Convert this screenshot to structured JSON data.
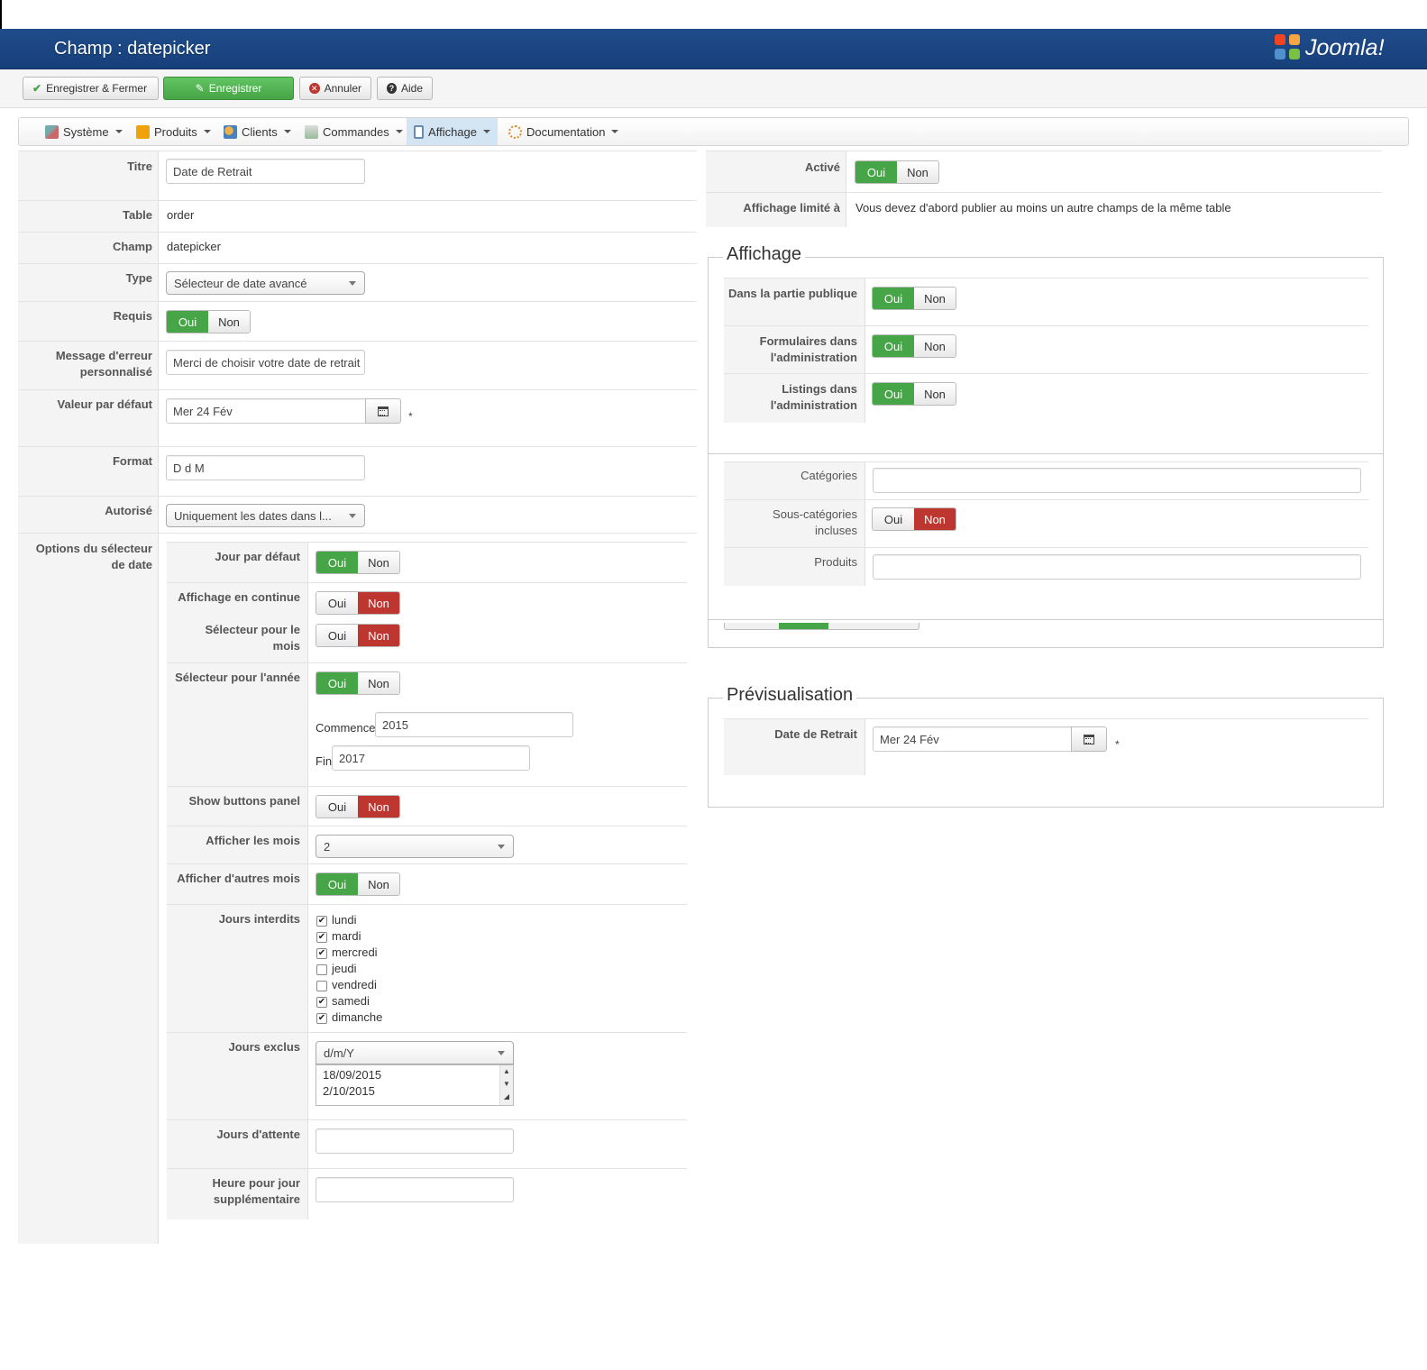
{
  "header": {
    "title": "Champ : datepicker",
    "logo_text": "Joomla!",
    "brand_color": "#1f4c8a"
  },
  "toolbar": {
    "save_close": "Enregistrer & Fermer",
    "save": "Enregistrer",
    "cancel": "Annuler",
    "help": "Aide"
  },
  "menu": {
    "items": [
      {
        "label": "Système",
        "icon": "tools-icon"
      },
      {
        "label": "Produits",
        "icon": "box-icon"
      },
      {
        "label": "Clients",
        "icon": "users-icon"
      },
      {
        "label": "Commandes",
        "icon": "cart-icon"
      },
      {
        "label": "Affichage",
        "icon": "display-icon",
        "active": true
      },
      {
        "label": "Documentation",
        "icon": "doc-icon"
      }
    ]
  },
  "toggle": {
    "yes": "Oui",
    "no": "Non"
  },
  "left": {
    "titre_label": "Titre",
    "titre_value": "Date de Retrait",
    "table_label": "Table",
    "table_value": "order",
    "champ_label": "Champ",
    "champ_value": "datepicker",
    "type_label": "Type",
    "type_value": "Sélecteur de date avancé",
    "requis_label": "Requis",
    "msg_label": "Message d'erreur personnalisé",
    "msg_value": "Merci de choisir votre date de retrait",
    "defaut_label": "Valeur par défaut",
    "defaut_value": "Mer 24 Fév",
    "star": "*",
    "format_label": "Format",
    "format_value": "D d M",
    "autorise_label": "Autorisé",
    "autorise_value": "Uniquement les dates dans l...",
    "options_label": "Options du sélecteur de date"
  },
  "options": {
    "jour_defaut": "Jour par défaut",
    "continue": "Affichage en continue",
    "sel_mois": "Sélecteur pour le mois",
    "sel_annee": "Sélecteur pour l'année",
    "commence_label": "Commence",
    "commence_value": "2015",
    "fin_label": "Fin",
    "fin_value": "2017",
    "show_buttons": "Show buttons panel",
    "afficher_mois": "Afficher les mois",
    "afficher_mois_value": "2",
    "autres_mois": "Afficher d'autres mois",
    "jours_interdits": "Jours interdits",
    "days": [
      {
        "label": "lundi",
        "checked": true
      },
      {
        "label": "mardi",
        "checked": true
      },
      {
        "label": "mercredi",
        "checked": true
      },
      {
        "label": "jeudi",
        "checked": false
      },
      {
        "label": "vendredi",
        "checked": false
      },
      {
        "label": "samedi",
        "checked": true
      },
      {
        "label": "dimanche",
        "checked": true
      }
    ],
    "jours_exclus": "Jours exclus",
    "jours_exclus_format": "d/m/Y",
    "jours_exclus_dates": [
      "18/09/2015",
      "2/10/2015"
    ],
    "jours_attente": "Jours d'attente",
    "heure_sup": "Heure pour jour supplémentaire"
  },
  "right": {
    "active_label": "Activé",
    "limite_label": "Affichage limité à",
    "limite_value": "Vous devez d'abord publier au moins un autre champs de la même table",
    "affichage_legend": "Affichage",
    "partie_publique": "Dans la partie publique",
    "formulaires_admin": "Formulaires dans l'administration",
    "listings_admin": "Listings dans l'administration",
    "categories": "Catégories",
    "sous_categories": "Sous-catégories incluses",
    "produits": "Produits",
    "preview_legend": "Prévisualisation",
    "preview_label": "Date de Retrait",
    "preview_value": "Mer 24 Fév",
    "star": "*"
  }
}
